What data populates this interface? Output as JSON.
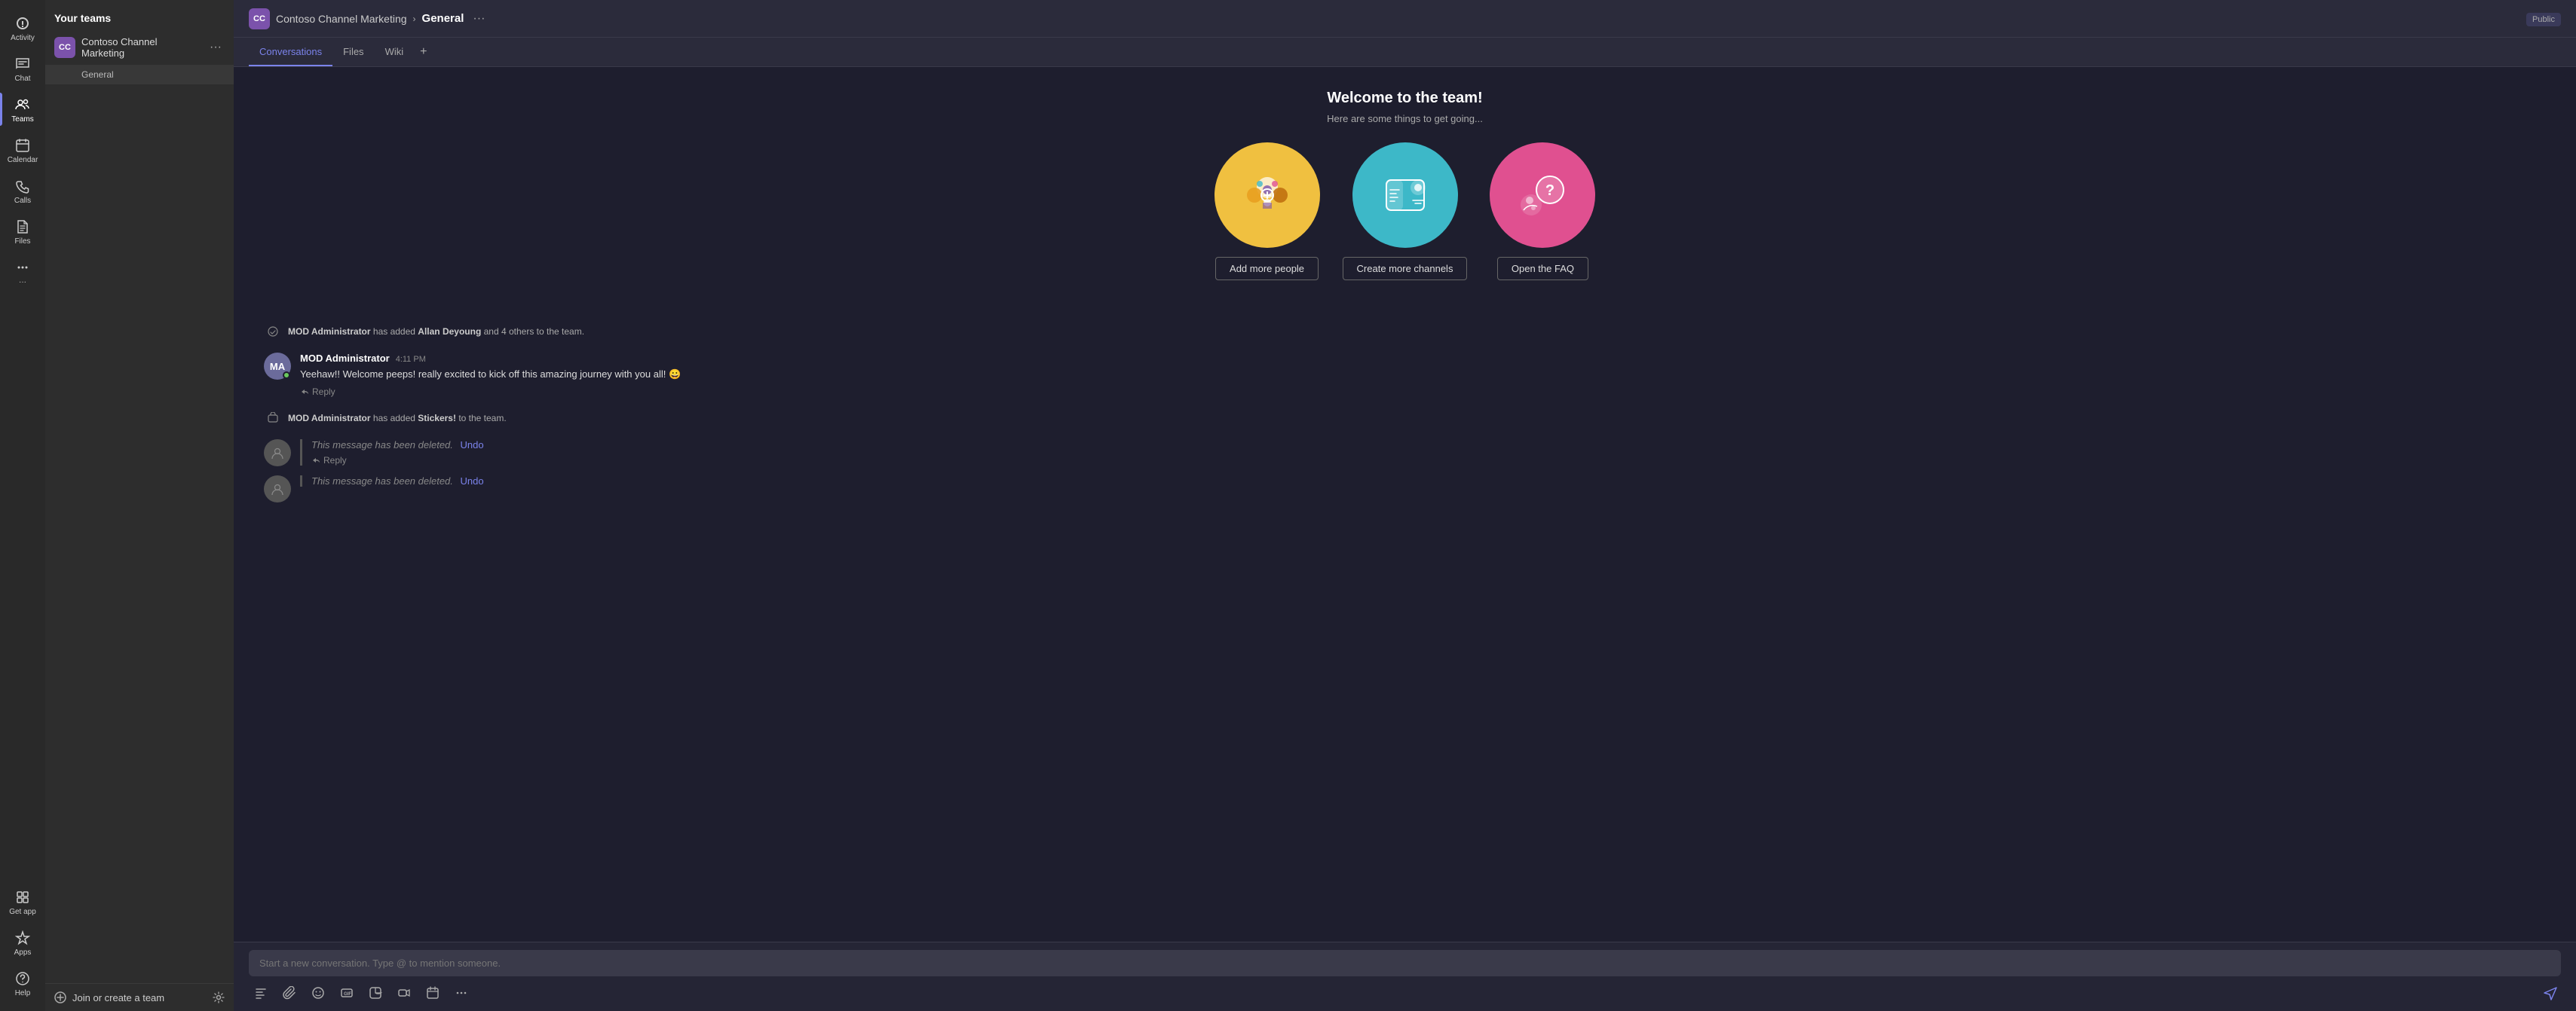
{
  "rail": {
    "items": [
      {
        "id": "activity",
        "label": "Activity",
        "icon": "activity"
      },
      {
        "id": "chat",
        "label": "Chat",
        "icon": "chat"
      },
      {
        "id": "teams",
        "label": "Teams",
        "icon": "teams",
        "active": true
      },
      {
        "id": "calendar",
        "label": "Calendar",
        "icon": "calendar"
      },
      {
        "id": "calls",
        "label": "Calls",
        "icon": "calls"
      },
      {
        "id": "files",
        "label": "Files",
        "icon": "files"
      },
      {
        "id": "more",
        "label": "...",
        "icon": "more"
      }
    ],
    "bottom": [
      {
        "id": "get-app",
        "label": "Get app",
        "icon": "get-app"
      },
      {
        "id": "apps",
        "label": "Apps",
        "icon": "apps"
      },
      {
        "id": "help",
        "label": "Help",
        "icon": "help"
      }
    ]
  },
  "sidebar": {
    "header": "Your teams",
    "teams": [
      {
        "id": "contoso",
        "initials": "CC",
        "name": "Contoso Channel Marketing",
        "channels": [
          "General"
        ]
      }
    ],
    "join_create_label": "Join or create a team"
  },
  "topbar": {
    "team_initials": "CC",
    "team_name": "Contoso Channel Marketing",
    "channel_name": "General",
    "public_badge": "Public"
  },
  "tabs": [
    {
      "id": "conversations",
      "label": "Conversations",
      "active": true
    },
    {
      "id": "files",
      "label": "Files",
      "active": false
    },
    {
      "id": "wiki",
      "label": "Wiki",
      "active": false
    }
  ],
  "welcome": {
    "title": "Welcome to the team!",
    "subtitle": "Here are some things to get going...",
    "cards": [
      {
        "id": "add-people",
        "button_label": "Add more people",
        "circle_class": "circle-yellow"
      },
      {
        "id": "create-channels",
        "button_label": "Create more channels",
        "circle_class": "circle-teal"
      },
      {
        "id": "open-faq",
        "button_label": "Open the FAQ",
        "circle_class": "circle-pink"
      }
    ]
  },
  "messages": [
    {
      "id": "system-1",
      "type": "system",
      "text_before": "MOD Administrator",
      "text_middle": " has added ",
      "text_highlight": "Allan Deyoung",
      "text_after": " and 4 others to the team."
    },
    {
      "id": "msg-1",
      "type": "chat",
      "avatar_initials": "MA",
      "author": "MOD Administrator",
      "time": "4:11 PM",
      "text": "Yeehaw!! Welcome peeps! really excited to kick off this amazing journey with you all! 😀",
      "reply_label": "Reply"
    },
    {
      "id": "system-2",
      "type": "system",
      "text_before": "MOD Administrator",
      "text_middle": " has added ",
      "text_highlight": "Stickers!",
      "text_after": " to the team."
    },
    {
      "id": "deleted-1",
      "type": "deleted",
      "deleted_text": "This message has been deleted.",
      "undo_label": "Undo",
      "reply_label": "Reply"
    },
    {
      "id": "deleted-2",
      "type": "deleted",
      "deleted_text": "This message has been deleted.",
      "undo_label": "Undo"
    }
  ],
  "compose": {
    "placeholder": "Start a new conversation. Type @ to mention someone.",
    "toolbar_icons": [
      {
        "id": "format",
        "icon": "format-icon"
      },
      {
        "id": "attach",
        "icon": "attach-icon"
      },
      {
        "id": "emoji",
        "icon": "emoji-icon"
      },
      {
        "id": "gif",
        "icon": "gif-icon"
      },
      {
        "id": "sticker",
        "icon": "sticker-icon"
      },
      {
        "id": "meet",
        "icon": "meet-icon"
      },
      {
        "id": "schedule",
        "icon": "schedule-icon"
      },
      {
        "id": "more",
        "icon": "more-icon"
      }
    ]
  }
}
